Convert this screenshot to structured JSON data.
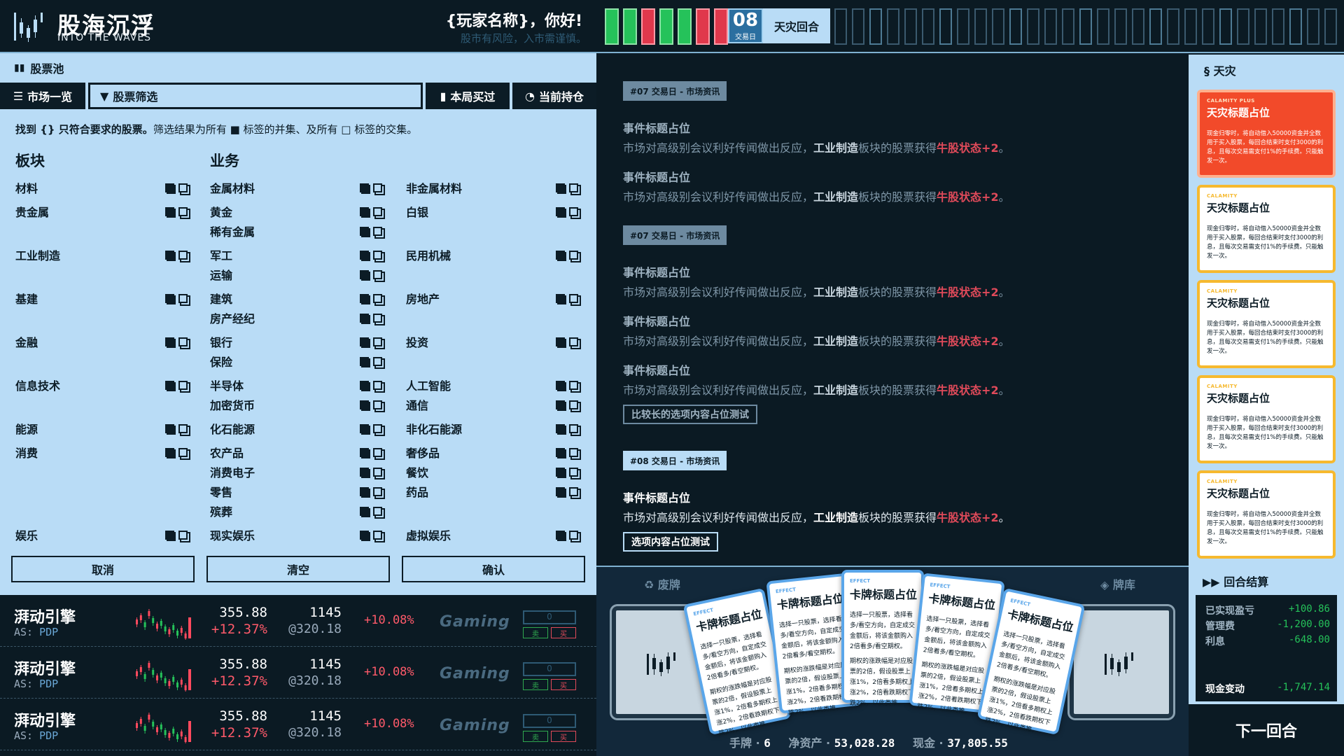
{
  "header": {
    "title_cn": "股海沉浮",
    "title_en": "INTO THE WAVES",
    "greeting": "{玩家名称}，你好!",
    "subgreeting": "股市有风险，入市需谨慎。"
  },
  "pool": {
    "title": "股票池",
    "tabs": [
      "市场一览",
      "股票筛选",
      "本局买过",
      "当前持仓"
    ],
    "hint_bold": "找到 {} 只符合要求的股票。",
    "hint_rest": "筛选结果为所有 ■ 标签的并集、及所有 □ 标签的交集。",
    "col_sector": "板块",
    "col_business": "业务",
    "sectors": [
      "材料",
      "贵金属",
      "工业制造",
      "基建",
      "金融",
      "信息技术",
      "能源",
      "消费",
      "娱乐"
    ],
    "business": [
      [
        "金属材料",
        "非金属材料"
      ],
      [
        "黄金",
        "白银"
      ],
      [
        "稀有金属",
        ""
      ],
      [
        "军工",
        "民用机械"
      ],
      [
        "运输",
        ""
      ],
      [
        "建筑",
        "房地产"
      ],
      [
        "房产经纪",
        ""
      ],
      [
        "银行",
        "投资"
      ],
      [
        "保险",
        ""
      ],
      [
        "半导体",
        "人工智能"
      ],
      [
        "加密货币",
        "通信"
      ],
      [
        "化石能源",
        "非化石能源"
      ],
      [
        "农产品",
        "奢侈品"
      ],
      [
        "消费电子",
        "餐饮"
      ],
      [
        "零售",
        "药品"
      ],
      [
        "殡葬",
        ""
      ],
      [
        "现实娱乐",
        "虚拟娱乐"
      ]
    ],
    "buttons": [
      "取消",
      "清空",
      "确认"
    ]
  },
  "stocks": [
    {
      "name": "湃动引擎",
      "code_prefix": "AS:",
      "code": "PDP",
      "price": "355.88",
      "pct": "+12.37%",
      "vol": "1145",
      "avg": "@320.18",
      "day": "+10.08%",
      "brand": "Gaming",
      "box": "0",
      "sell": "卖",
      "buy": "买"
    },
    {
      "name": "湃动引擎",
      "code_prefix": "AS:",
      "code": "PDP",
      "price": "355.88",
      "pct": "+12.37%",
      "vol": "1145",
      "avg": "@320.18",
      "day": "+10.08%",
      "brand": "Gaming",
      "box": "0",
      "sell": "卖",
      "buy": "买"
    },
    {
      "name": "湃动引擎",
      "code_prefix": "AS:",
      "code": "PDP",
      "price": "355.88",
      "pct": "+12.37%",
      "vol": "1145",
      "avg": "@320.18",
      "day": "+10.08%",
      "brand": "Gaming",
      "box": "0",
      "sell": "卖",
      "buy": "买"
    }
  ],
  "timeline": {
    "day": "08",
    "day_label": "交易日",
    "round_label": "天灾回合",
    "ticks": [
      "g",
      "g",
      "r",
      "g",
      "g",
      "r",
      "r"
    ]
  },
  "news": {
    "badge1": "#07 交易日 - 市场资讯",
    "badge2": "#07 交易日 - 市场资讯",
    "badge3": "#08 交易日 - 市场资讯",
    "event_title": "事件标题占位",
    "event_pre": "市场对高级别会议利好传闻做出反应，",
    "event_sector": "工业制造",
    "event_mid": "板块的股票获得",
    "event_effect": "牛股状态+2",
    "event_end": "。",
    "option_long": "比较长的选项内容占位测试",
    "option": "选项内容占位测试"
  },
  "calamity": {
    "title": "天灾",
    "cards": [
      {
        "tag": "CALAMITY PLUS",
        "title": "天灾标题占位",
        "text": "现金归零时，将自动借入50000资金并全数用于买入股票，每回合结束时支付3000的利息，且每次交易需支付1%的手续费。只能触发一次。"
      },
      {
        "tag": "CALAMITY",
        "title": "天灾标题占位",
        "text": "现金归零时，将自动借入50000资金并全数用于买入股票，每回合结束时支付3000的利息，且每次交易需支付1%的手续费。只能触发一次。"
      },
      {
        "tag": "CALAMITY",
        "title": "天灾标题占位",
        "text": "现金归零时，将自动借入50000资金并全数用于买入股票，每回合结束时支付3000的利息，且每次交易需支付1%的手续费。只能触发一次。"
      },
      {
        "tag": "CALAMITY",
        "title": "天灾标题占位",
        "text": "现金归零时，将自动借入50000资金并全数用于买入股票，每回合结束时支付3000的利息，且每次交易需支付1%的手续费。只能触发一次。"
      },
      {
        "tag": "CALAMITY",
        "title": "天灾标题占位",
        "text": "现金归零时，将自动借入50000资金并全数用于买入股票，每回合结束时支付3000的利息，且每次交易需支付1%的手续费。只能触发一次。"
      }
    ]
  },
  "hand": {
    "discard": "废牌",
    "deck": "牌库",
    "card": {
      "tag": "EFFECT",
      "title": "卡牌标题占位",
      "text1": "选择一只股票，选择看多/看空方向，自定成交金额后，将该金额购入2倍看多/看空期权。",
      "text2": "期权的涨跌幅是对应股票的2倍，假设股票上涨1%，2倍看多期权上涨2%，2倍看跌期权下跌2%，以此类推。"
    },
    "hand_label": "手牌",
    "hand_count": "6",
    "net_label": "净资产",
    "net": "53,028.28",
    "cash_label": "现金",
    "cash": "37,805.55"
  },
  "settle": {
    "title": "回合结算",
    "realized_label": "已实现盈亏",
    "realized": "+100.86",
    "mgmt_label": "管理费",
    "mgmt": "-1,200.00",
    "interest_label": "利息",
    "interest": "-648.00",
    "cash_change_label": "现金变动",
    "cash_change": "-1,747.14",
    "next": "下一回合"
  },
  "colors": {
    "accent": "#b9dcf6",
    "bg": "#0b1a23",
    "up": "#ff5a6a",
    "green": "#25c25a",
    "calamity": "#f6b92f",
    "calamity_plus": "#f24a2a"
  }
}
